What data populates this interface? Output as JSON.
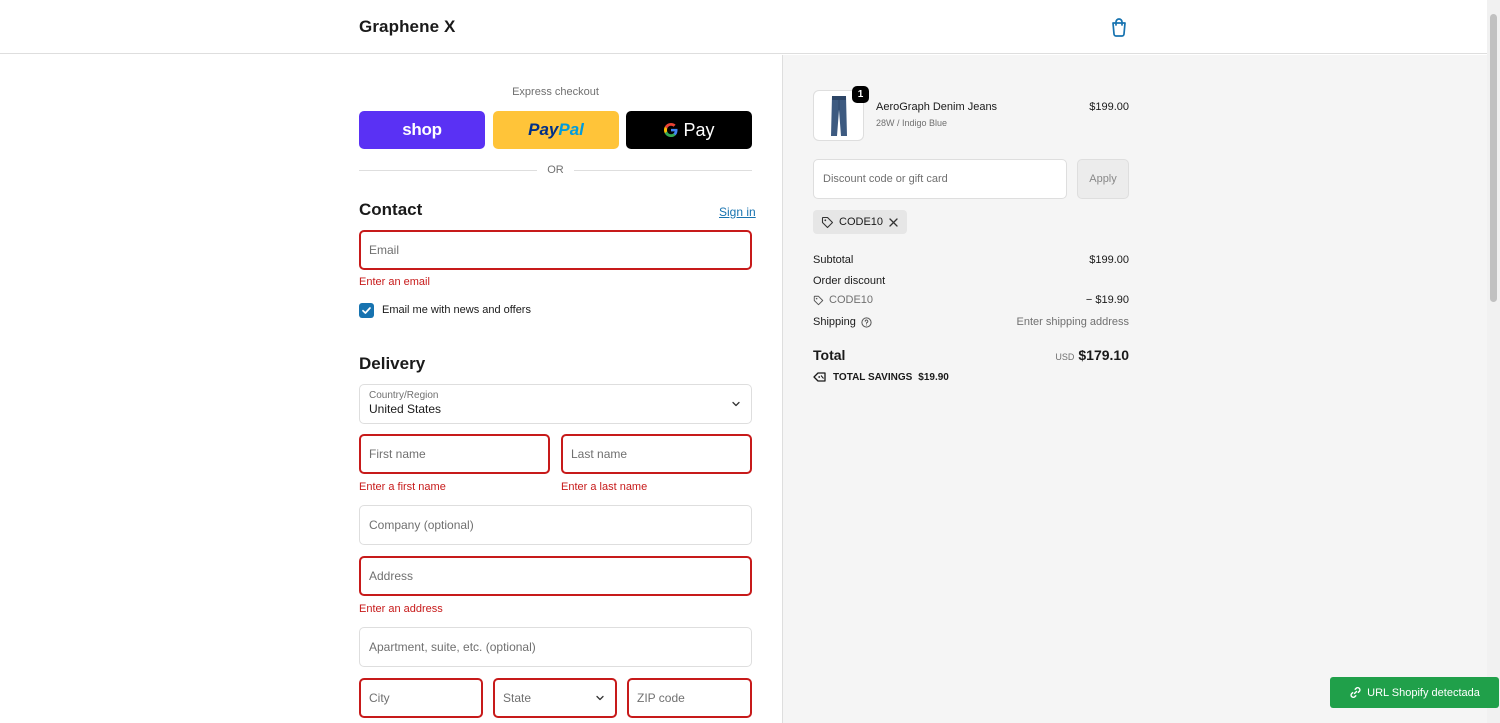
{
  "header": {
    "store_name": "Graphene X",
    "cart_icon": "shopping-bag-icon"
  },
  "express": {
    "label": "Express checkout",
    "shop_label": "shop",
    "paypal_pay": "Pay",
    "paypal_pal": "Pal",
    "gpay_g": "G",
    "gpay_label": "Pay",
    "or": "OR"
  },
  "contact": {
    "title": "Contact",
    "sign_in": "Sign in",
    "email_placeholder": "Email",
    "email_error": "Enter an email",
    "newsletter_label": "Email me with news and offers",
    "newsletter_checked": true
  },
  "delivery": {
    "title": "Delivery",
    "country_label": "Country/Region",
    "country_value": "United States",
    "first_name_placeholder": "First name",
    "first_name_error": "Enter a first name",
    "last_name_placeholder": "Last name",
    "last_name_error": "Enter a last name",
    "company_placeholder": "Company (optional)",
    "address_placeholder": "Address",
    "address_error": "Enter an address",
    "apartment_placeholder": "Apartment, suite, etc. (optional)",
    "city_placeholder": "City",
    "state_placeholder": "State",
    "zip_placeholder": "ZIP code"
  },
  "summary": {
    "product": {
      "quantity": "1",
      "name": "AeroGraph Denim Jeans",
      "variant": "28W / Indigo Blue",
      "price": "$199.00"
    },
    "discount_placeholder": "Discount code or gift card",
    "apply_label": "Apply",
    "applied_code": "CODE10",
    "subtotal_label": "Subtotal",
    "subtotal_value": "$199.00",
    "order_discount_label": "Order discount",
    "discount_code": "CODE10",
    "discount_value": "− $19.90",
    "shipping_label": "Shipping",
    "shipping_value": "Enter shipping address",
    "total_label": "Total",
    "total_currency": "USD",
    "total_value": "$179.10",
    "savings_label": "TOTAL SAVINGS",
    "savings_value": "$19.90"
  },
  "toast": {
    "label": "URL Shopify detectada"
  },
  "colors": {
    "shop_purple": "#5a31f4",
    "paypal_yellow": "#ffc439",
    "error_red": "#c71a1a",
    "link_blue": "#1773b0",
    "toast_green": "#20a04a"
  }
}
